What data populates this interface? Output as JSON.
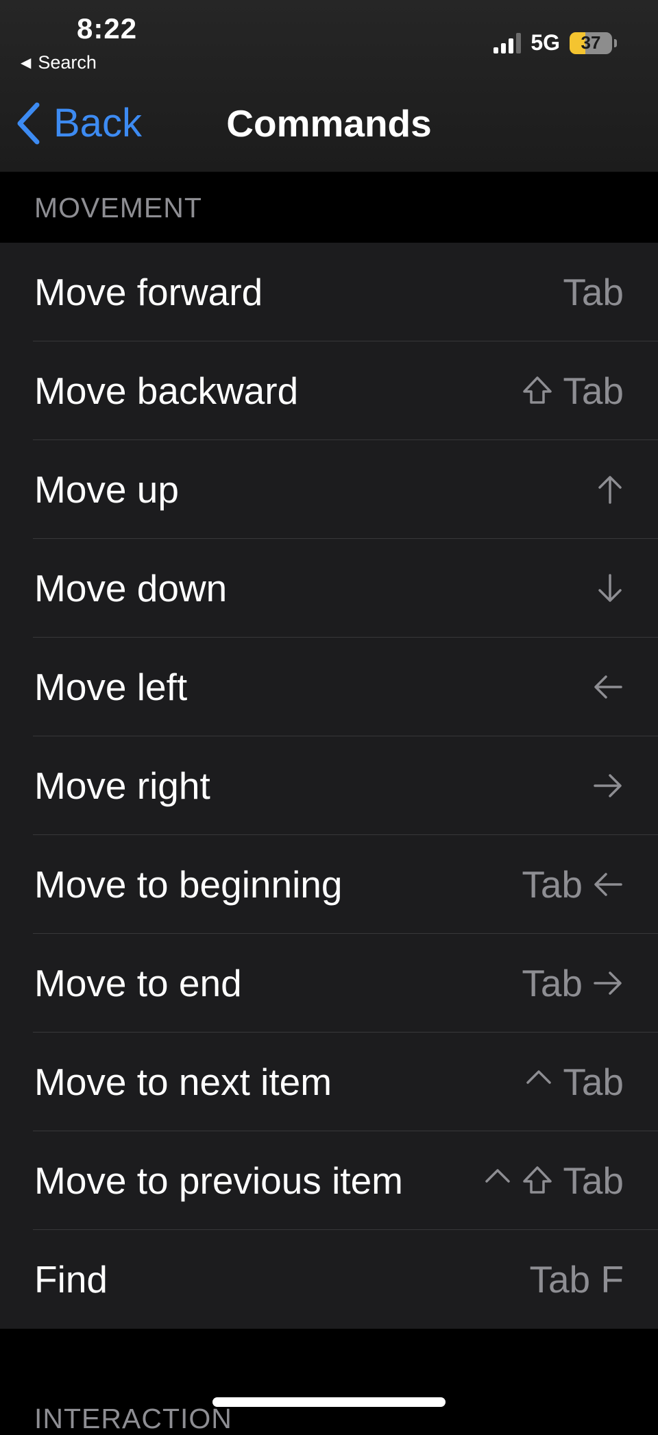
{
  "status_bar": {
    "time": "8:22",
    "back_app": "Search",
    "network": "5G",
    "battery": "37"
  },
  "nav": {
    "back_label": "Back",
    "title": "Commands"
  },
  "sections": [
    {
      "header": "MOVEMENT",
      "items": [
        {
          "label": "Move forward",
          "key_text": "Tab"
        },
        {
          "label": "Move backward",
          "key_text": "Tab"
        },
        {
          "label": "Move up"
        },
        {
          "label": "Move down"
        },
        {
          "label": "Move left"
        },
        {
          "label": "Move right"
        },
        {
          "label": "Move to beginning",
          "key_text": "Tab"
        },
        {
          "label": "Move to end",
          "key_text": "Tab"
        },
        {
          "label": "Move to next item",
          "key_text": "Tab"
        },
        {
          "label": "Move to previous item",
          "key_text": "Tab"
        },
        {
          "label": "Find",
          "key_text": "Tab F"
        }
      ]
    },
    {
      "header": "INTERACTION"
    }
  ],
  "colors": {
    "accent": "#3d8bf2",
    "cell_background": "#1c1c1e",
    "secondary_text": "#8e8e93",
    "battery_fill": "#f4c430"
  }
}
